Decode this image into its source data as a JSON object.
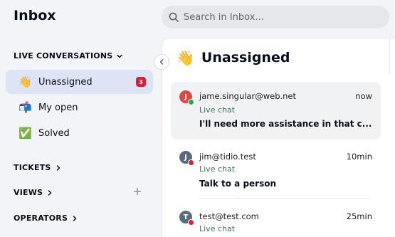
{
  "header": {
    "title": "Inbox"
  },
  "search": {
    "placeholder": "Search in Inbox..."
  },
  "sidebar": {
    "live_section": "LIVE CONVERSATIONS",
    "items": [
      {
        "label": "Unassigned",
        "emoji": "👋",
        "badge": "3"
      },
      {
        "label": "My open",
        "emoji": "📬"
      },
      {
        "label": "Solved",
        "emoji": "✅"
      }
    ],
    "tickets": "TICKETS",
    "views": "VIEWS",
    "operators": "OPERATORS"
  },
  "panel": {
    "title": "Unassigned",
    "emoji": "👋"
  },
  "conversations": [
    {
      "initial": "J",
      "email": "jame.singular@web.net",
      "time": "now",
      "channel": "Live chat",
      "message": "I'll need more assistance in that c...",
      "avatar_color": "#e0473e",
      "status_color": "#28a745"
    },
    {
      "initial": "J",
      "email": "jim@tidio.test",
      "time": "10min",
      "channel": "Live chat",
      "message": "Talk to a person",
      "avatar_color": "#5b6b7b",
      "status_color": "#e11d35"
    },
    {
      "initial": "T",
      "email": "test@test.com",
      "time": "25min",
      "channel": "Live chat",
      "message": "",
      "avatar_color": "#5b6b7b",
      "status_color": "#e11d35"
    }
  ],
  "colors": {
    "active_nav": "#dce4f5",
    "badge": "#e11d35",
    "channel_text": "#3b7a52"
  }
}
